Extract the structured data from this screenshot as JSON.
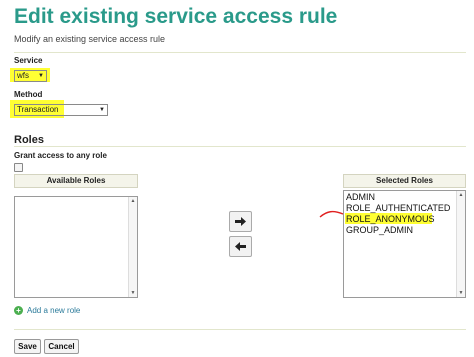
{
  "page": {
    "title": "Edit existing service access rule",
    "subtitle": "Modify an existing service access rule"
  },
  "form": {
    "service_label": "Service",
    "service_value": "wfs",
    "method_label": "Method",
    "method_value": "Transaction"
  },
  "roles": {
    "section_title": "Roles",
    "grant_any_label": "Grant access to any role",
    "grant_any_checked": false,
    "available_header": "Available Roles",
    "selected_header": "Selected Roles",
    "available_items": [],
    "selected_items": [
      "ADMIN",
      "ROLE_AUTHENTICATED",
      "ROLE_ANONYMOUS",
      "GROUP_ADMIN"
    ],
    "add_role_label": "Add a new role"
  },
  "buttons": {
    "save_label": "Save",
    "cancel_label": "Cancel"
  },
  "icons": {
    "move_right": "arrow-right-icon",
    "move_left": "arrow-left-icon",
    "add": "plus-circle-icon",
    "dropdown": "triangle-down-icon"
  },
  "colors": {
    "title": "#2a9a8a",
    "highlight": "#ffff33",
    "annotation": "#e02020",
    "link": "#2a7a9a"
  }
}
